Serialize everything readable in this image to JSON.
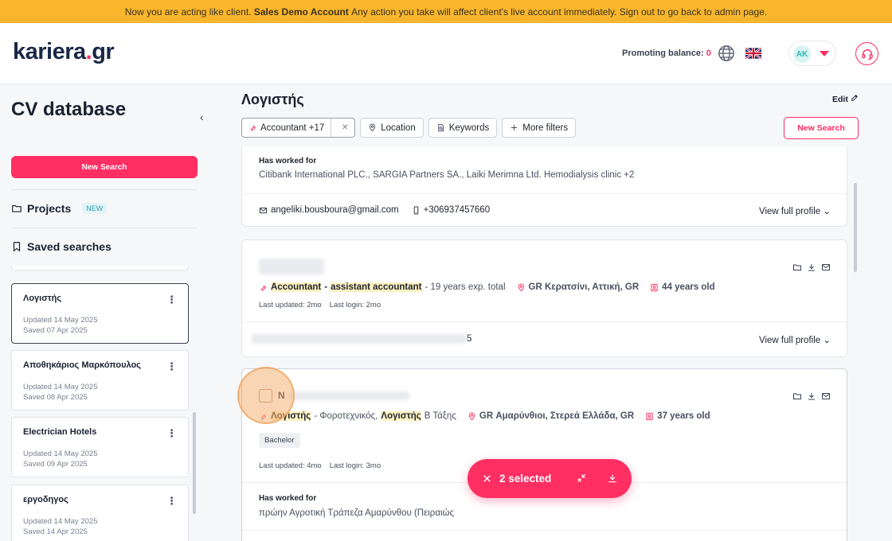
{
  "banner": {
    "prefix": "Now you are acting like client.",
    "account": "Sales Demo Account",
    "suffix": "Any action you take will affect client's live account immediately. Sign out to go back to admin page."
  },
  "header": {
    "logo_main": "kariera",
    "logo_dot": ".",
    "logo_tld": "gr",
    "promo_label": "Promoting balance:",
    "promo_value": "0",
    "avatar_initials": "AK"
  },
  "sidebar": {
    "title": "CV database",
    "collapse_icon": "‹",
    "new_search": "New Search",
    "projects_label": "Projects",
    "projects_badge": "NEW",
    "saved_label": "Saved searches",
    "saved_searches": [
      {
        "name": "Λογιστής",
        "updated": "Updated 14 May 2025",
        "saved": "Saved 07 Apr 2025"
      },
      {
        "name": "Αποθηκάριος Μαρκόπουλος",
        "updated": "Updated 14 May 2025",
        "saved": "Saved 08 Apr 2025"
      },
      {
        "name": "Electrician Hotels",
        "updated": "Updated 14 May 2025",
        "saved": "Saved 09 Apr 2025"
      },
      {
        "name": "εργοδηγος",
        "updated": "Updated 14 May 2025",
        "saved": "Saved 14 Apr 2025"
      }
    ]
  },
  "main": {
    "title": "Λογιστής",
    "edit_label": "Edit",
    "filters": {
      "keyword_chip": "Accountant +17",
      "clear": "✕",
      "location": "Location",
      "keywords": "Keywords",
      "more_filters": "More filters"
    },
    "new_search": "New Search",
    "cards": [
      {
        "worked_label": "Has worked for",
        "worked_text": "Citibank International PLC., SARGIA Partners SA., Laiki Merimna Ltd. Hemodialysis clinic +2",
        "email": "angeliki.bousboura@gmail.com",
        "phone": "+306937457660",
        "view": "View full profile"
      },
      {
        "title_hl1": "Accountant",
        "title_sep": "-",
        "title_hl2": "assistant accountant",
        "experience": "- 19 years exp. total",
        "location": "GR Κερατσίνι, Αττική, GR",
        "age": "44 years old",
        "last_updated": "Last updated: 2mo",
        "last_login": "Last login: 2mo",
        "contact_tail": "5",
        "view": "View full profile"
      },
      {
        "name_initial": "N",
        "title_hl1": "Λογιστής",
        "title_mid": "- Φοροτεχνικός,",
        "title_hl2": "Λογιστής",
        "title_end": "Β Τάξης",
        "location": "GR Αμαρύνθιοι, Στερεά Ελλάδα, GR",
        "age": "37 years old",
        "tag": "Bachelor",
        "last_updated": "Last updated: 4mo",
        "last_login": "Last login: 3mo",
        "worked_label": "Has worked for",
        "worked_text": "πρώην Αγροτική Τράπεζα Αμαρύνθου (Πειραιώς"
      }
    ],
    "selection": {
      "count": "2 selected"
    }
  },
  "colors": {
    "accent": "#ff2e63",
    "banner": "#f9b62c",
    "highlight": "#fff2c2"
  }
}
